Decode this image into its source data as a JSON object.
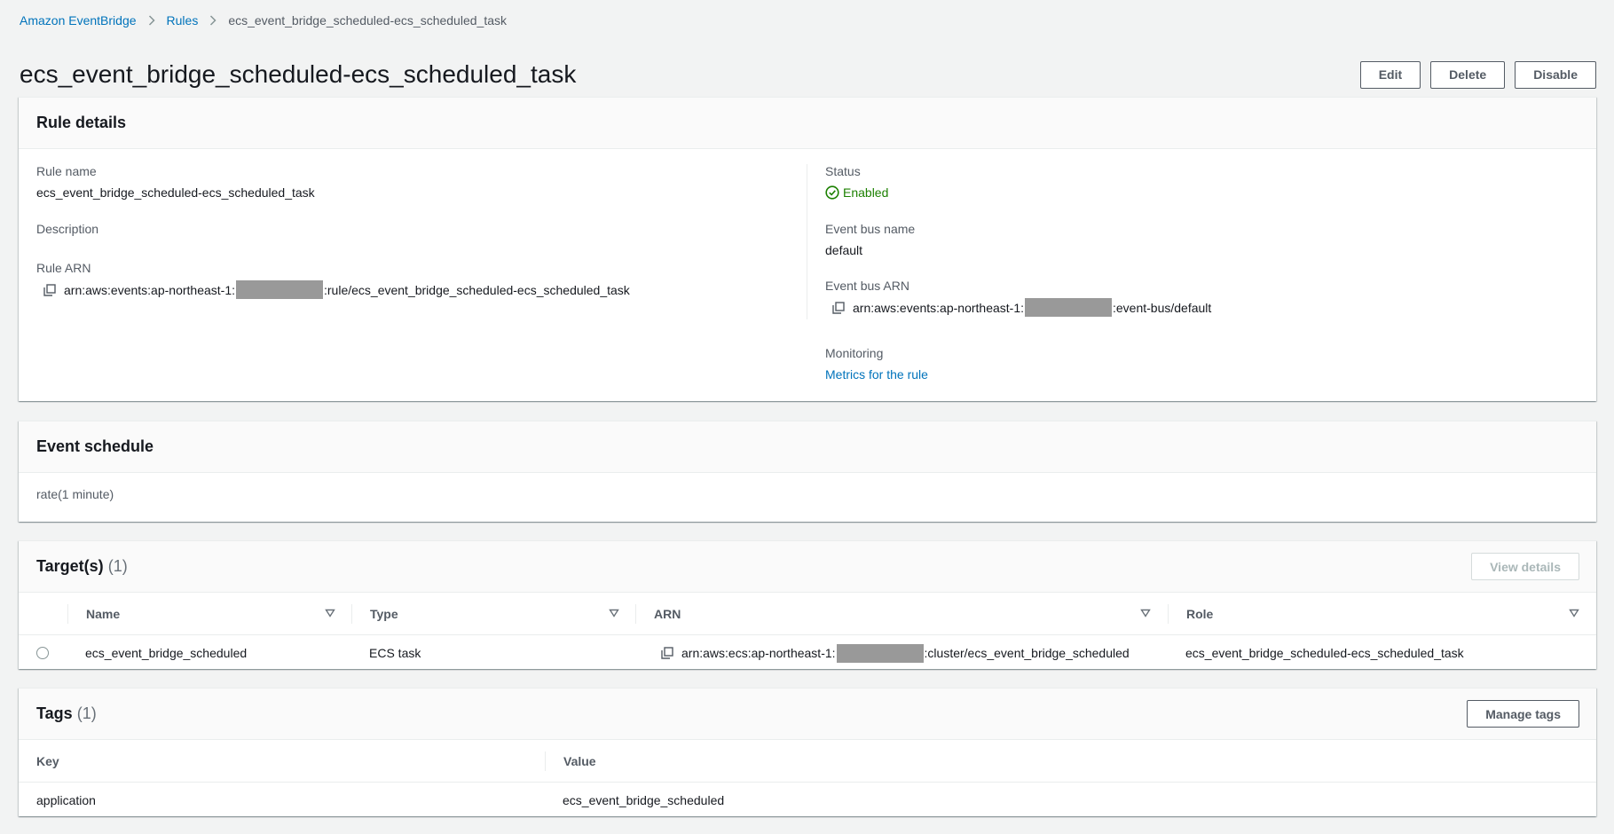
{
  "breadcrumb": {
    "root": "Amazon EventBridge",
    "rules": "Rules",
    "current": "ecs_event_bridge_scheduled-ecs_scheduled_task"
  },
  "page": {
    "title": "ecs_event_bridge_scheduled-ecs_scheduled_task",
    "edit_label": "Edit",
    "delete_label": "Delete",
    "disable_label": "Disable"
  },
  "rule_details": {
    "title": "Rule details",
    "rule_name_label": "Rule name",
    "rule_name": "ecs_event_bridge_scheduled-ecs_scheduled_task",
    "description_label": "Description",
    "rule_arn_label": "Rule ARN",
    "rule_arn_prefix": "arn:aws:events:ap-northeast-1:",
    "rule_arn_suffix": ":rule/ecs_event_bridge_scheduled-ecs_scheduled_task",
    "status_label": "Status",
    "status": "Enabled",
    "event_bus_name_label": "Event bus name",
    "event_bus_name": "default",
    "event_bus_arn_label": "Event bus ARN",
    "event_bus_arn_prefix": "arn:aws:events:ap-northeast-1:",
    "event_bus_arn_suffix": ":event-bus/default",
    "monitoring_label": "Monitoring",
    "monitoring_link": "Metrics for the rule"
  },
  "event_schedule": {
    "title": "Event schedule",
    "value": "rate(1 minute)"
  },
  "targets": {
    "title": "Target(s)",
    "count": "(1)",
    "view_details_label": "View details",
    "columns": [
      "Name",
      "Type",
      "ARN",
      "Role"
    ],
    "rows": [
      {
        "name": "ecs_event_bridge_scheduled",
        "type": "ECS task",
        "arn_prefix": "arn:aws:ecs:ap-northeast-1:",
        "arn_suffix": ":cluster/ecs_event_bridge_scheduled",
        "role": "ecs_event_bridge_scheduled-ecs_scheduled_task"
      }
    ]
  },
  "tags": {
    "title": "Tags",
    "count": "(1)",
    "manage_label": "Manage tags",
    "columns": [
      "Key",
      "Value"
    ],
    "rows": [
      {
        "key": "application",
        "value": "ecs_event_bridge_scheduled"
      }
    ]
  },
  "colors": {
    "link": "#0073bb",
    "success": "#1d8102",
    "background": "#f2f3f3",
    "redacted": "#999999"
  }
}
